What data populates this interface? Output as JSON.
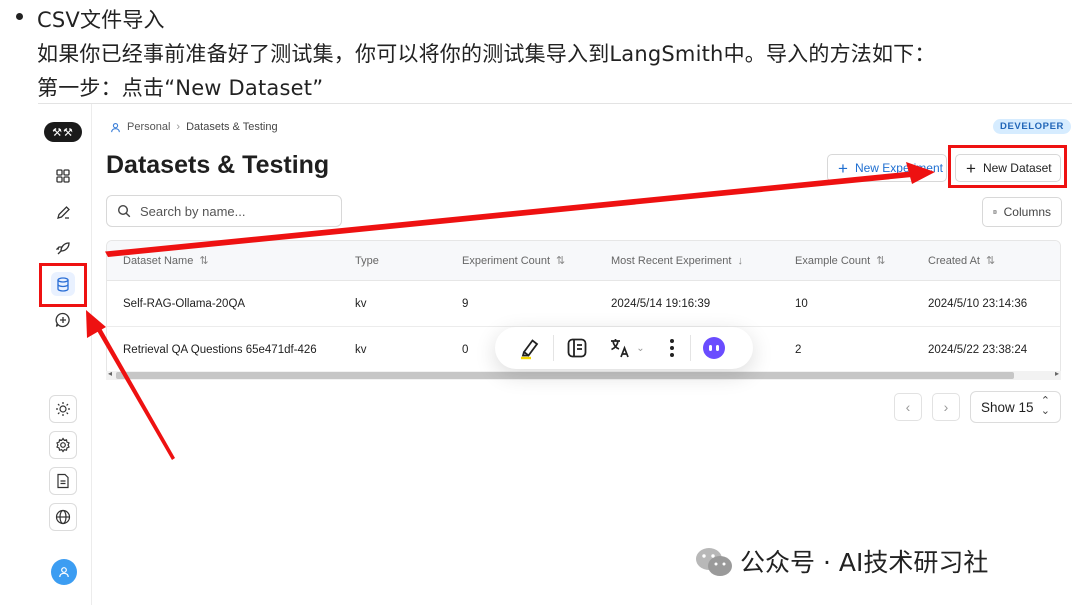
{
  "doc": {
    "bullet_text": "CSV文件导入",
    "line2": "如果你已经事前准备好了测试集，你可以将你的测试集导入到LangSmith中。导入的方法如下：",
    "line3": "第一步：点击“New Dataset”"
  },
  "app": {
    "logo_icon": "langsmith-logo",
    "breadcrumb": {
      "workspace": "Personal",
      "page": "Datasets & Testing"
    },
    "env_badge": "DEVELOPER",
    "title": "Datasets & Testing",
    "buttons": {
      "new_experiment": "New Experiment",
      "new_dataset": "New Dataset",
      "columns": "Columns"
    },
    "search": {
      "placeholder": "Search by name...",
      "value": ""
    },
    "table": {
      "columns": [
        "Dataset Name",
        "Type",
        "Experiment Count",
        "Most Recent Experiment",
        "Example Count",
        "Created At"
      ],
      "rows": [
        [
          "Self-RAG-Ollama-20QA",
          "kv",
          "9",
          "2024/5/14 19:16:39",
          "10",
          "2024/5/10 23:14:36"
        ],
        [
          "Retrieval QA Questions 65e471df-426",
          "kv",
          "0",
          "",
          "2",
          "2024/5/22 23:38:24"
        ]
      ]
    },
    "pagination": {
      "show_label": "Show 15"
    },
    "sidebar_icons": [
      "grid-icon",
      "pen-icon",
      "rocket-icon",
      "database-icon",
      "chat-plus-icon",
      "sun-icon",
      "gear-icon",
      "document-icon",
      "globe-icon",
      "user-icon"
    ]
  },
  "colors": {
    "accent": "#1f6fd1",
    "annotation_red": "#ee1111",
    "badge_bg": "#d6ecff",
    "bot_purple": "#6a4cff"
  },
  "watermark": {
    "text": "公众号 · AI技术研习社"
  }
}
